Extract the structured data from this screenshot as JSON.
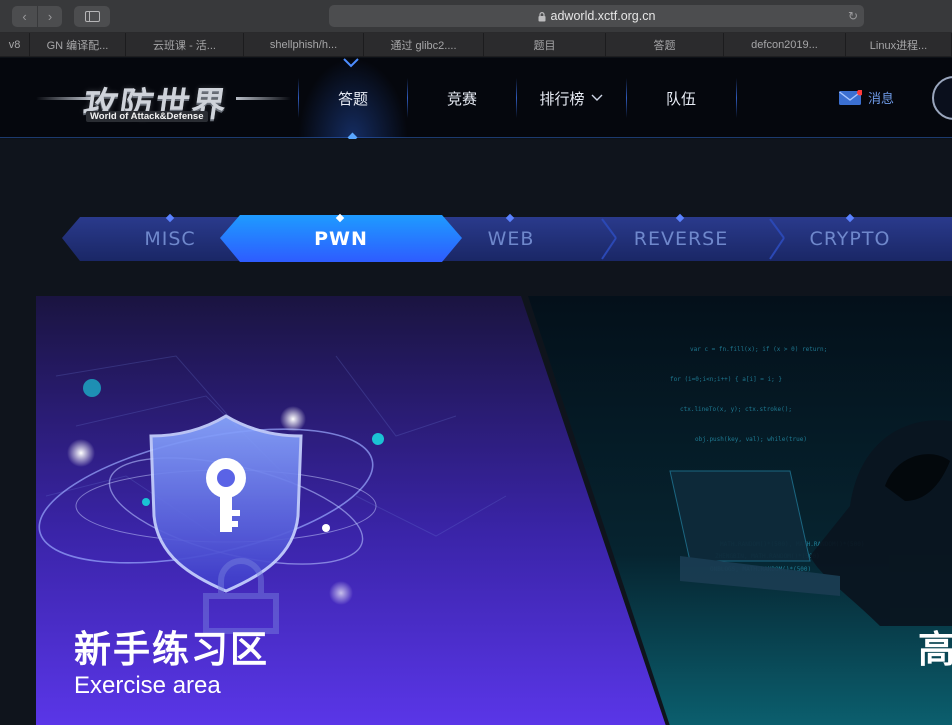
{
  "browser": {
    "url": "adworld.xctf.org.cn",
    "back_glyph": "‹",
    "forward_glyph": "›",
    "reload_glyph": "↻",
    "tabs": [
      {
        "label": "v8",
        "w": 30
      },
      {
        "label": "GN 编译配...",
        "w": 96
      },
      {
        "label": "云班课 - 活...",
        "w": 118
      },
      {
        "label": "shellphish/h...",
        "w": 120
      },
      {
        "label": "通过 glibc2....",
        "w": 120
      },
      {
        "label": "题目",
        "w": 122
      },
      {
        "label": "答题",
        "w": 118
      },
      {
        "label": "defcon2019...",
        "w": 122
      },
      {
        "label": "Linux进程...",
        "w": 106
      }
    ]
  },
  "site": {
    "logo_title": "攻防世界",
    "logo_subtitle": "World of Attack&Defense",
    "nav": [
      {
        "label": "答题",
        "active": true
      },
      {
        "label": "竞赛",
        "active": false
      },
      {
        "label": "排行榜",
        "active": false,
        "has_dropdown": true
      },
      {
        "label": "队伍",
        "active": false
      }
    ],
    "messages_label": "消息",
    "accent_color": "#3f7bff"
  },
  "categories": [
    {
      "label": "MISC",
      "active": false
    },
    {
      "label": "PWN",
      "active": true
    },
    {
      "label": "WEB",
      "active": false
    },
    {
      "label": "REVERSE",
      "active": false
    },
    {
      "label": "CRYPTO",
      "active": false
    }
  ],
  "cards": [
    {
      "title": "新手练习区",
      "subtitle": "Exercise area",
      "icon": "shield-key-icon"
    },
    {
      "title": "高",
      "subtitle": "",
      "icon": "hacker-laptop-image"
    }
  ]
}
